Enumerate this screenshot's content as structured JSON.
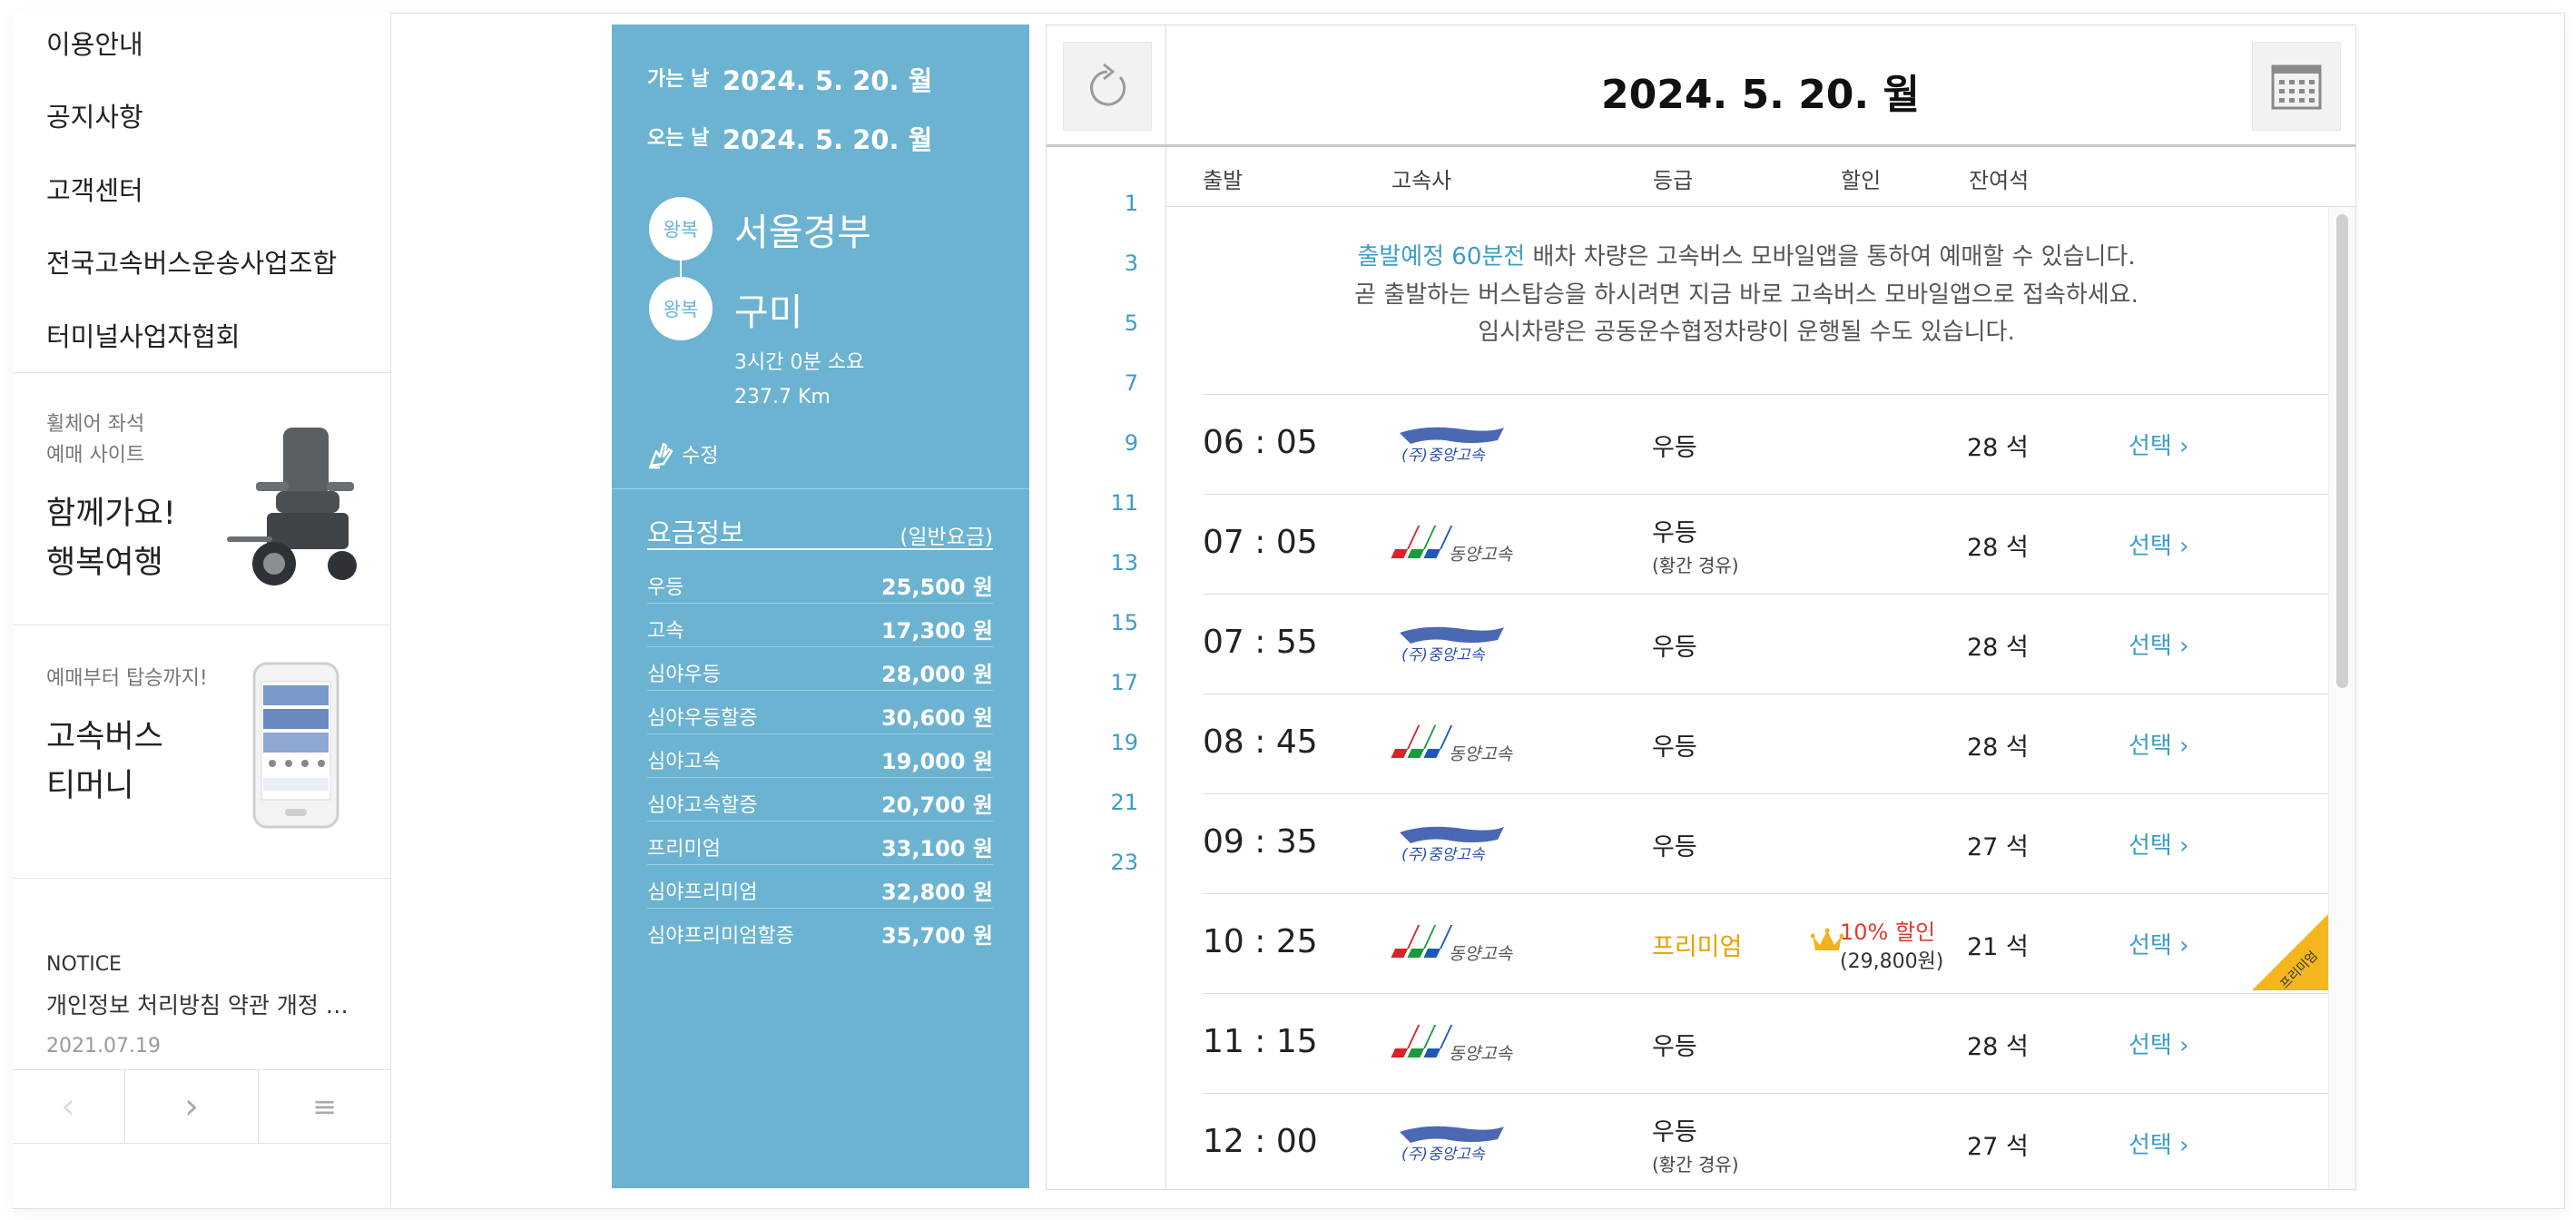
{
  "sidebar": {
    "menu": [
      "이용안내",
      "공지사항",
      "고객센터",
      "전국고속버스운송사업조합",
      "터미널사업자협회"
    ],
    "promo1": {
      "sub1": "휠체어 좌석",
      "sub2": "예매 사이트",
      "big1": "함께가요!",
      "big2": "행복여행"
    },
    "promo2": {
      "sub": "예매부터 탑승까지!",
      "big1": "고속버스",
      "big2": "티머니"
    },
    "notice": {
      "label": "NOTICE",
      "title": "개인정보 처리방침 약관 개정 …",
      "date": "2021.07.19"
    },
    "pager": {
      "prev": "‹",
      "next": "›",
      "menu": "≡"
    }
  },
  "trip": {
    "depart_label": "가는 날",
    "depart_date": "2024. 5. 20. 월",
    "return_label": "오는 날",
    "return_date": "2024. 5. 20. 월",
    "badge": "왕복",
    "origin": "서울경부",
    "destination": "구미",
    "duration": "3시간 0분 소요",
    "distance": "237.7 Km",
    "edit_label": "수정"
  },
  "fares": {
    "title": "요금정보",
    "note": "(일반요금)",
    "rows": [
      {
        "name": "우등",
        "price": "25,500 원"
      },
      {
        "name": "고속",
        "price": "17,300 원"
      },
      {
        "name": "심야우등",
        "price": "28,000 원"
      },
      {
        "name": "심야우등할증",
        "price": "30,600 원"
      },
      {
        "name": "심야고속",
        "price": "19,000 원"
      },
      {
        "name": "심야고속할증",
        "price": "20,700 원"
      },
      {
        "name": "프리미엄",
        "price": "33,100 원"
      },
      {
        "name": "심야프리미엄",
        "price": "32,800 원"
      },
      {
        "name": "심야프리미엄할증",
        "price": "35,700 원"
      }
    ]
  },
  "schedule": {
    "date_title": "2024. 5. 20. 월",
    "hours": [
      "1",
      "3",
      "5",
      "7",
      "9",
      "11",
      "13",
      "15",
      "17",
      "19",
      "21",
      "23"
    ],
    "columns": {
      "depart": "출발",
      "company": "고속사",
      "grade": "등급",
      "discount": "할인",
      "seats": "잔여석"
    },
    "notice": {
      "highlight": "출발예정 60분전",
      "line1_rest": " 배차 차량은 고속버스 모바일앱을 통하여 예매할 수 있습니다.",
      "line2": "곧 출발하는 버스탑승을 하시려면 지금 바로 고속버스 모바일앱으로 접속하세요.",
      "line3": "임시차량은 공동운수협정차량이 운행될 수도 있습니다."
    },
    "rows": [
      {
        "time": "06 : 05",
        "logo": "jungang-logo",
        "grade": "우등",
        "via": "",
        "discount": "",
        "discount_price": "",
        "seats": "28 석",
        "select": "선택 ›"
      },
      {
        "time": "07 : 05",
        "logo": "dongyang-logo",
        "grade": "우등",
        "via": "(황간 경유)",
        "discount": "",
        "discount_price": "",
        "seats": "28 석",
        "select": "선택 ›"
      },
      {
        "time": "07 : 55",
        "logo": "jungang-logo",
        "grade": "우등",
        "via": "",
        "discount": "",
        "discount_price": "",
        "seats": "28 석",
        "select": "선택 ›"
      },
      {
        "time": "08 : 45",
        "logo": "dongyang-logo",
        "grade": "우등",
        "via": "",
        "discount": "",
        "discount_price": "",
        "seats": "28 석",
        "select": "선택 ›"
      },
      {
        "time": "09 : 35",
        "logo": "jungang-logo",
        "grade": "우등",
        "via": "",
        "discount": "",
        "discount_price": "",
        "seats": "27 석",
        "select": "선택 ›"
      },
      {
        "time": "10 : 25",
        "logo": "dongyang-logo",
        "grade": "프리미엄",
        "via": "",
        "discount": "10% 할인",
        "discount_price": "(29,800원)",
        "seats": "21 석",
        "select": "선택 ›",
        "premium_tag": "프리미엄"
      },
      {
        "time": "11 : 15",
        "logo": "dongyang-logo",
        "grade": "우등",
        "via": "",
        "discount": "",
        "discount_price": "",
        "seats": "28 석",
        "select": "선택 ›"
      },
      {
        "time": "12 : 00",
        "logo": "jungang-logo",
        "grade": "우등",
        "via": "(황간 경유)",
        "discount": "",
        "discount_price": "",
        "seats": "27 석",
        "select": "선택 ›"
      }
    ]
  },
  "colors": {
    "panel_blue": "#6bb3d1",
    "link_blue": "#3d9cc7",
    "premium_gold": "#e8a000",
    "discount_red": "#e03a2e"
  },
  "logo_text": {
    "jungang": "(주)중앙고속",
    "dongyang": "동양고속"
  }
}
